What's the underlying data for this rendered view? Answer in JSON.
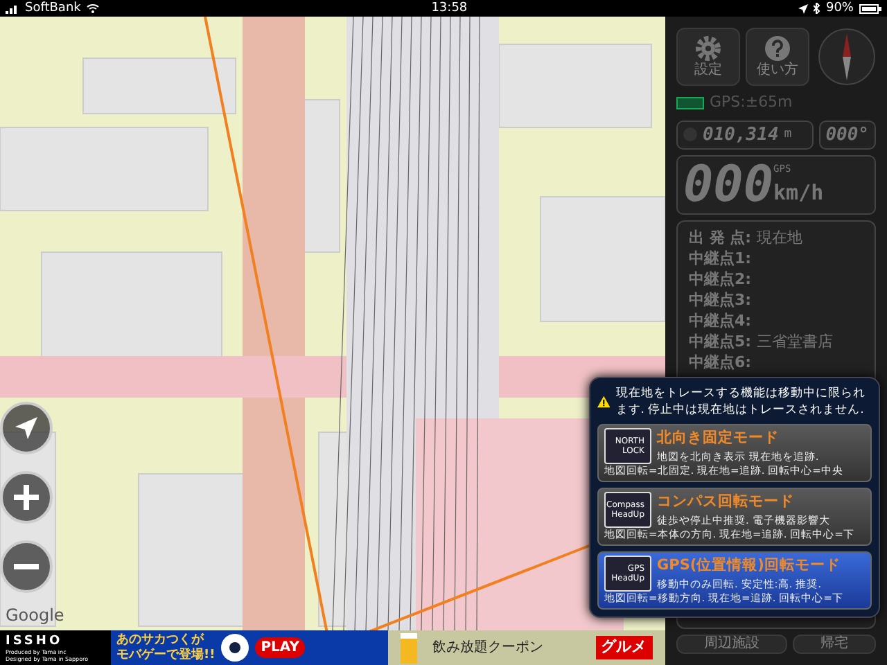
{
  "status_bar": {
    "carrier": "SoftBank",
    "time": "13:58",
    "battery": "90%"
  },
  "map": {
    "attribution": "Google"
  },
  "panel": {
    "buttons": [
      {
        "kind": "gear",
        "label": "設定"
      },
      {
        "kind": "help",
        "label": "使い方"
      }
    ],
    "gps_accuracy": "GPS:±65m",
    "distance": "010,314",
    "distance_unit": "m",
    "heading": "000°",
    "speed": "000",
    "speed_source": "GPS",
    "speed_unit": "km/h",
    "route": [
      {
        "label": "出 発 点:",
        "value": "現在地"
      },
      {
        "label": "中継点1:"
      },
      {
        "label": "中継点2:"
      },
      {
        "label": "中継点3:"
      },
      {
        "label": "中継点4:"
      },
      {
        "label": "中継点5:",
        "value": "三省堂書店"
      },
      {
        "label": "中継点6:"
      }
    ],
    "bottom_buttons": [
      "周辺施設",
      "帰宅"
    ]
  },
  "ads": {
    "logo": "ISSHO",
    "logo_sub": [
      "Produced by Tama inc",
      "Designed by Tama in Sapporo"
    ],
    "banner": [
      "あのサカつくが",
      "モバゲーで登場!!"
    ],
    "play": "PLAY",
    "coupon": "飲み放題クーポン",
    "gourmet": "グルメ"
  },
  "popup": {
    "warning": "現在地をトレースする機能は移動中に限られます. 停止中は現在地はトレースされません.",
    "modes": [
      {
        "icon_text": [
          "NORTH",
          "LOCK"
        ],
        "title": "北向き固定モード",
        "lines": [
          "地図を北向き表示 現在地を追跡.",
          "地図回転=北固定. 現在地=追跡. 回転中心=中央"
        ],
        "selected": false
      },
      {
        "icon_text": [
          "Compass",
          "HeadUp"
        ],
        "title": "コンパス回転モード",
        "lines": [
          "徒歩や停止中推奨. 電子機器影響大",
          "地図回転=本体の方向. 現在地=追跡. 回転中心=下"
        ],
        "selected": false
      },
      {
        "icon_text": [
          "GPS",
          "HeadUp"
        ],
        "title": "GPS(位置情報)回転モード",
        "lines": [
          "移動中のみ回転. 安定性:高. 推奨.",
          "地図回転=移動方向. 現在地=追跡. 回転中心=下"
        ],
        "selected": true
      }
    ]
  }
}
